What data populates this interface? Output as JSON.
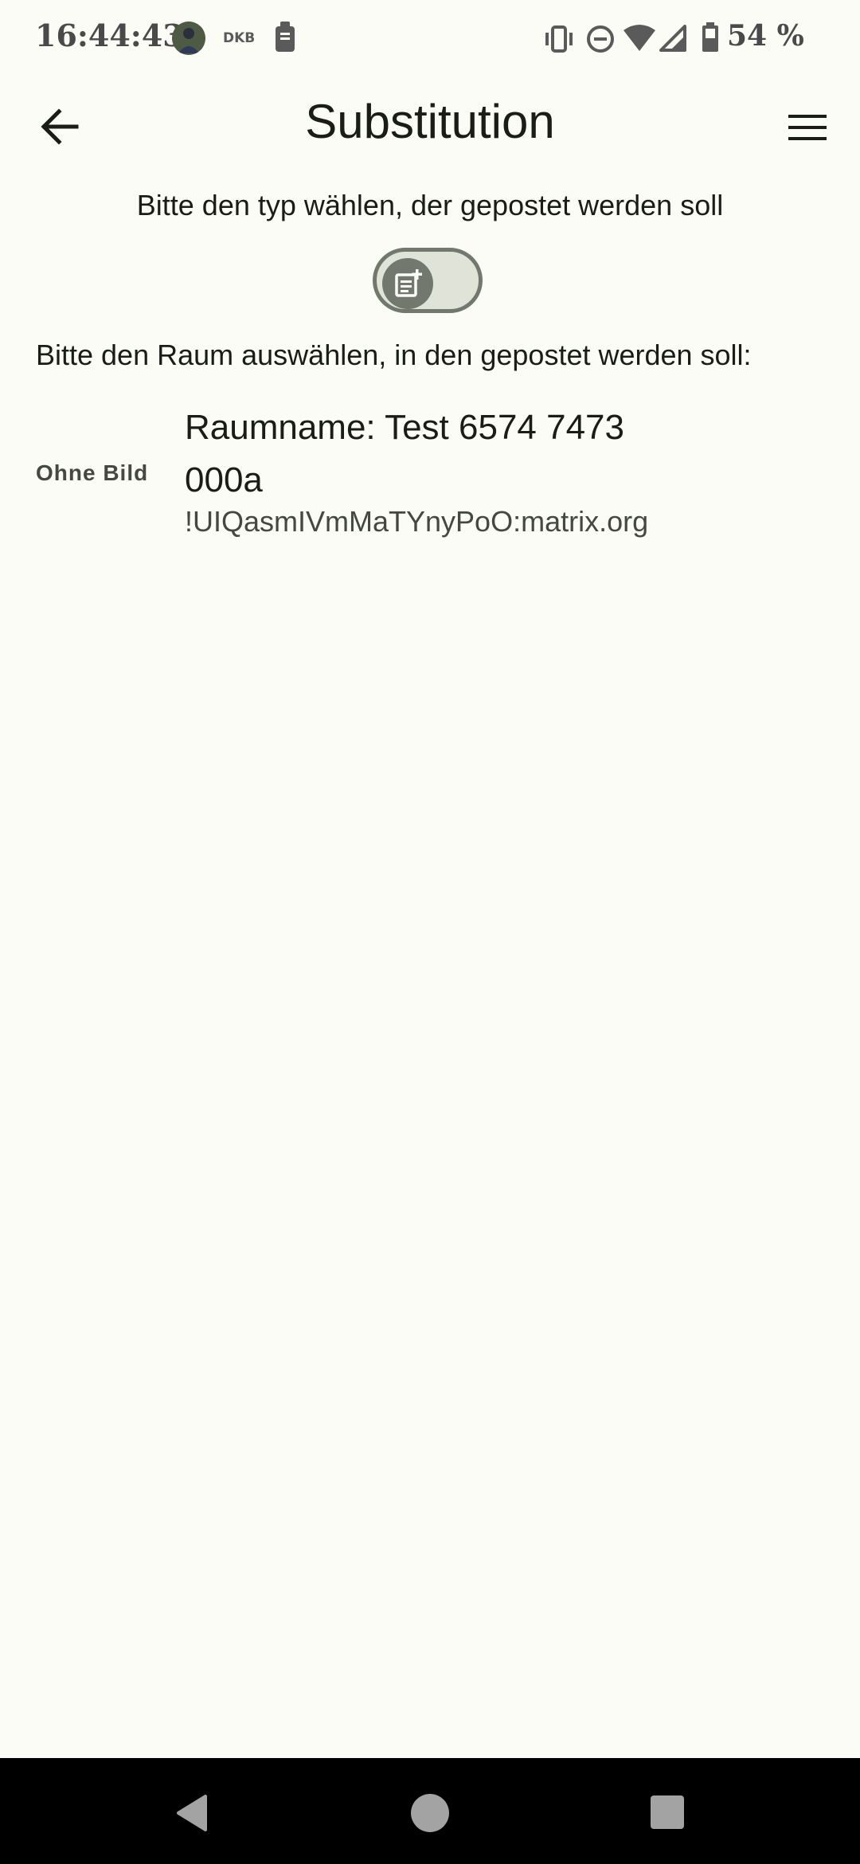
{
  "status_bar": {
    "time": "16:44:43",
    "carrier_label": "DKB",
    "battery_text": "54 %",
    "icons": [
      "avatar-icon",
      "note-icon",
      "vibrate-icon",
      "do-not-disturb-icon",
      "wifi-icon",
      "signal-icon",
      "battery-icon"
    ]
  },
  "app_bar": {
    "title": "Substitution",
    "back_icon": "arrow-back-icon",
    "menu_icon": "menu-icon"
  },
  "type_selection": {
    "prompt": "Bitte den typ wählen, der gepostet werden soll",
    "toggle_icon": "post-add-icon",
    "toggle_on": false
  },
  "room_selection": {
    "prompt": "Bitte den Raum auswählen, in den gepostet werden soll:",
    "rooms": [
      {
        "avatar_text": "Ohne Bild",
        "name": "Raumname: Test 6574 7473 000a",
        "id": "!UIQasmIVmMaTYnyPoO:matrix.org"
      }
    ]
  },
  "nav_bar": {
    "buttons": [
      "back-nav-icon",
      "home-nav-icon",
      "recents-nav-icon"
    ]
  },
  "colors": {
    "background": "#fcfcf7",
    "toggle_track": "#e0e4d8",
    "toggle_outline": "#72786e",
    "text_primary": "#1a1c18",
    "text_secondary": "#44483f",
    "nav_bar": "#000000"
  }
}
